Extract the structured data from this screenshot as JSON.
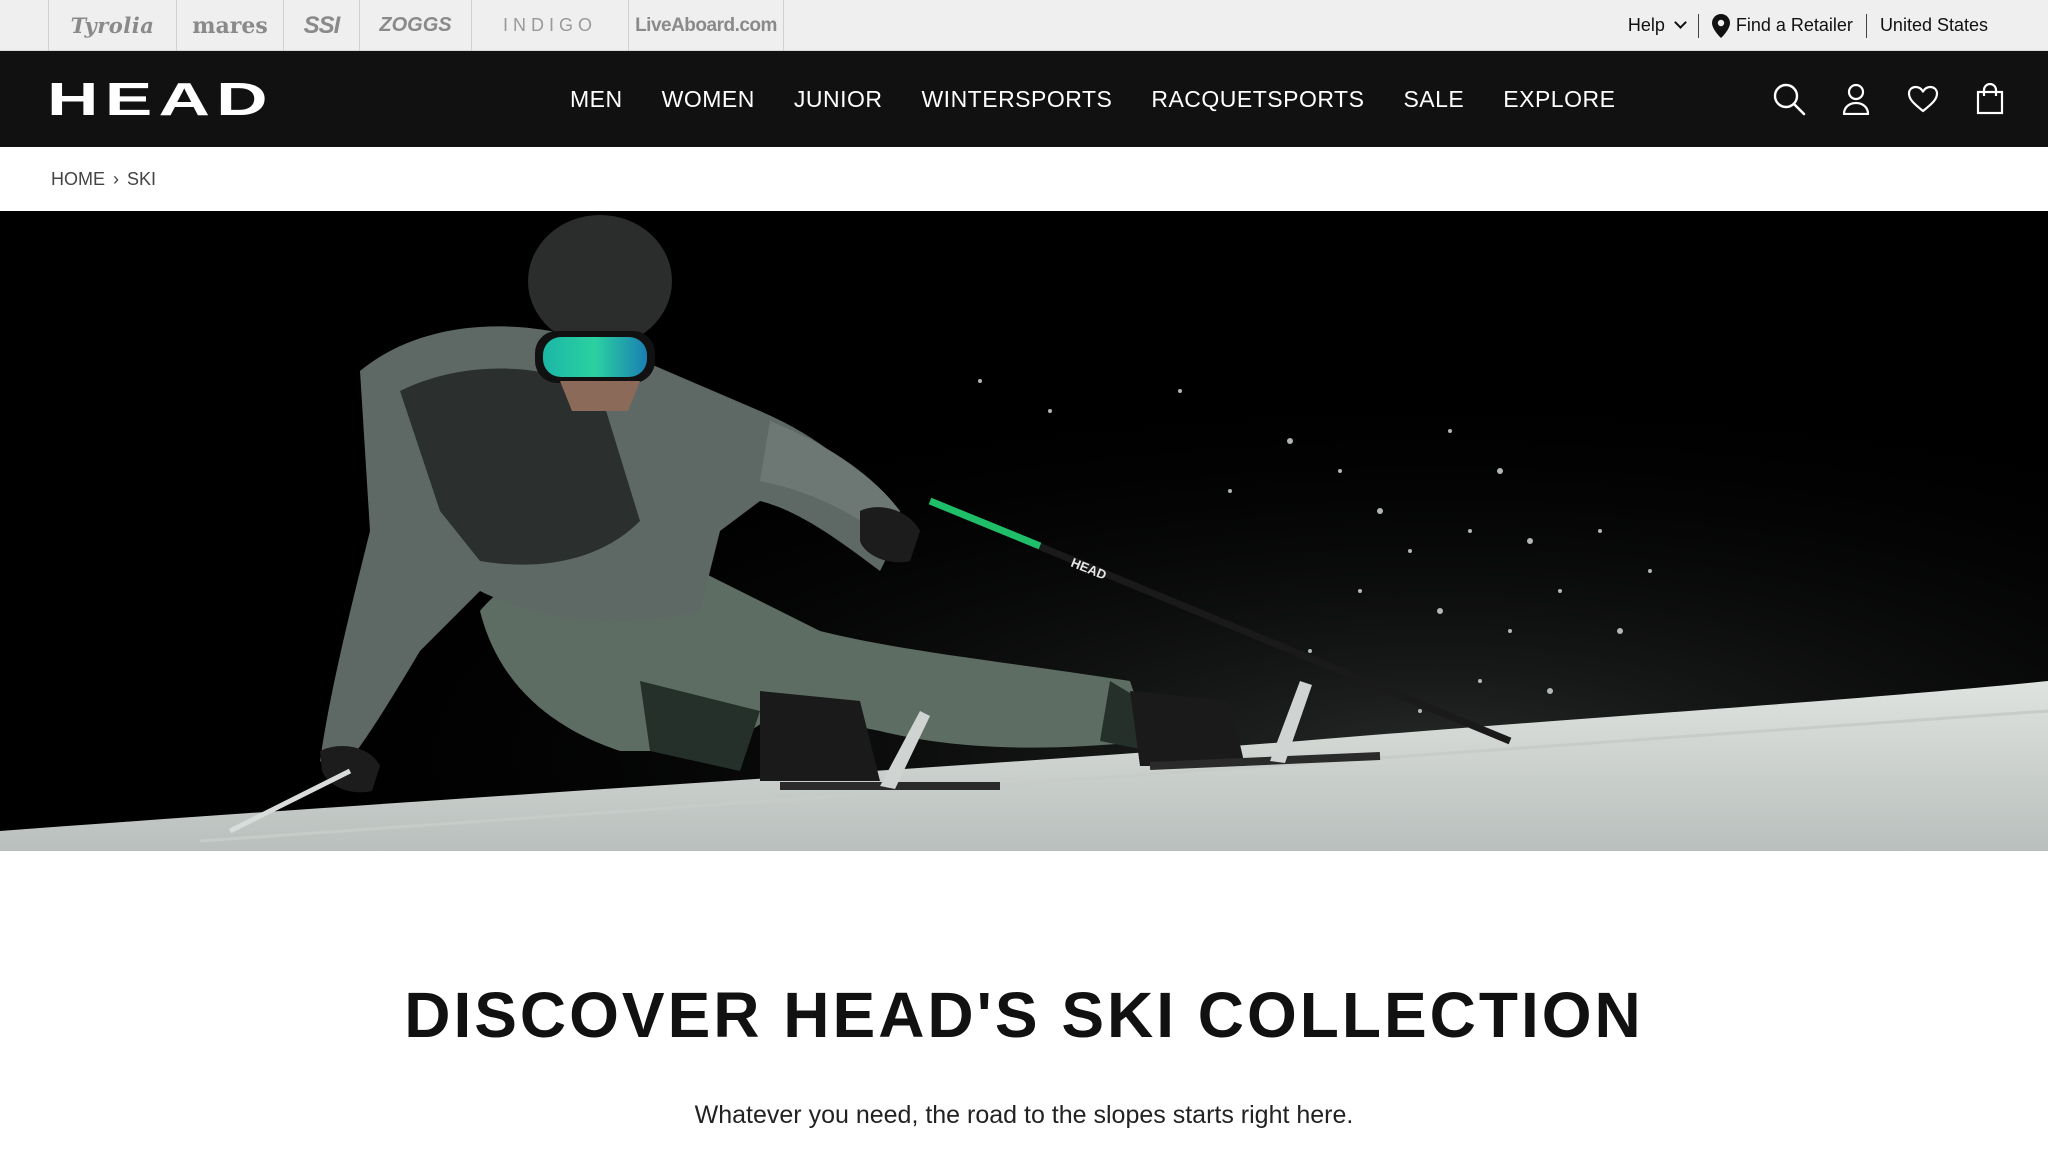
{
  "brand_bar": {
    "brands": [
      "Tyrolia",
      "mares",
      "SSI",
      "ZOGGS",
      "INDIGO",
      "LiveAboard.com"
    ],
    "help_label": "Help",
    "retailer_label": "Find a Retailer",
    "region_label": "United States"
  },
  "nav": {
    "logo": "HEAD",
    "links": [
      "MEN",
      "WOMEN",
      "JUNIOR",
      "WINTERSPORTS",
      "RACQUETSPORTS",
      "SALE",
      "EXPLORE"
    ],
    "icons": [
      "search-icon",
      "account-icon",
      "wishlist-icon",
      "cart-icon"
    ]
  },
  "breadcrumb": {
    "home": "HOME",
    "separator": "›",
    "current": "SKI"
  },
  "hero": {
    "pole_brand": "HEAD"
  },
  "content": {
    "title": "DISCOVER HEAD'S SKI COLLECTION",
    "subtitle": "Whatever you need, the road to the slopes starts right here."
  },
  "colors": {
    "brand_bar_bg": "#efefef",
    "nav_bg": "#111111",
    "accent_green": "#1fbf6a"
  }
}
